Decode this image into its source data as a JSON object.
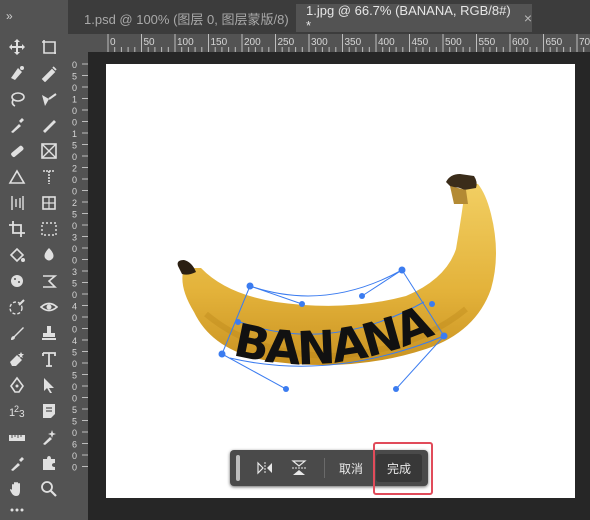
{
  "tabs": [
    {
      "label": "1.psd @ 100% (图层 0, 图层蒙版/8)",
      "close": "×",
      "active": false
    },
    {
      "label": "1.jpg @ 66.7% (BANANA, RGB/8#) *",
      "close": "×",
      "active": true
    }
  ],
  "ruler": {
    "h_labels": [
      "0",
      "50",
      "100",
      "150",
      "200",
      "250",
      "300",
      "350",
      "400",
      "450",
      "500",
      "550",
      "600",
      "650",
      "700"
    ],
    "v_labels": [
      "0",
      "5",
      "0",
      "1",
      "0",
      "0",
      "1",
      "5",
      "0",
      "2",
      "0",
      "0",
      "2",
      "5",
      "0",
      "3",
      "0",
      "0",
      "3",
      "5",
      "0",
      "4",
      "0",
      "0",
      "4",
      "5",
      "0",
      "5",
      "0",
      "0",
      "5",
      "5",
      "0",
      "6",
      "0",
      "0"
    ]
  },
  "canvas": {
    "text": "BANANA"
  },
  "warp_bar": {
    "cancel_label": "取消",
    "done_label": "完成"
  },
  "tools": [
    "move-icon",
    "artboard-icon",
    "quick-select-icon",
    "brush-alt-icon",
    "lasso-icon",
    "magic-wand-icon",
    "eyedropper-icon",
    "pen-icon",
    "healing-brush-icon",
    "frame-icon",
    "triangle-icon",
    "type-vertical-icon",
    "crop-perspective-icon",
    "slice-icon",
    "crop-icon",
    "marquee-icon",
    "paint-bucket-icon",
    "blur-drop-icon",
    "sponge-icon",
    "warp-shape-icon",
    "history-brush-icon",
    "eye-icon",
    "brush-icon",
    "stamp-icon",
    "eraser-icon",
    "type-icon",
    "pen-tool-icon",
    "path-select-icon",
    "count-icon",
    "note-icon",
    "ruler-icon",
    "color-sampler-icon",
    "eyedropper-alt-icon",
    "puzzle-icon",
    "hand-icon",
    "zoom-icon",
    "more-icon"
  ],
  "colors": {
    "highlight": "#e14b5a",
    "banana": "#e8b93a",
    "handle": "#3b7cf0"
  }
}
